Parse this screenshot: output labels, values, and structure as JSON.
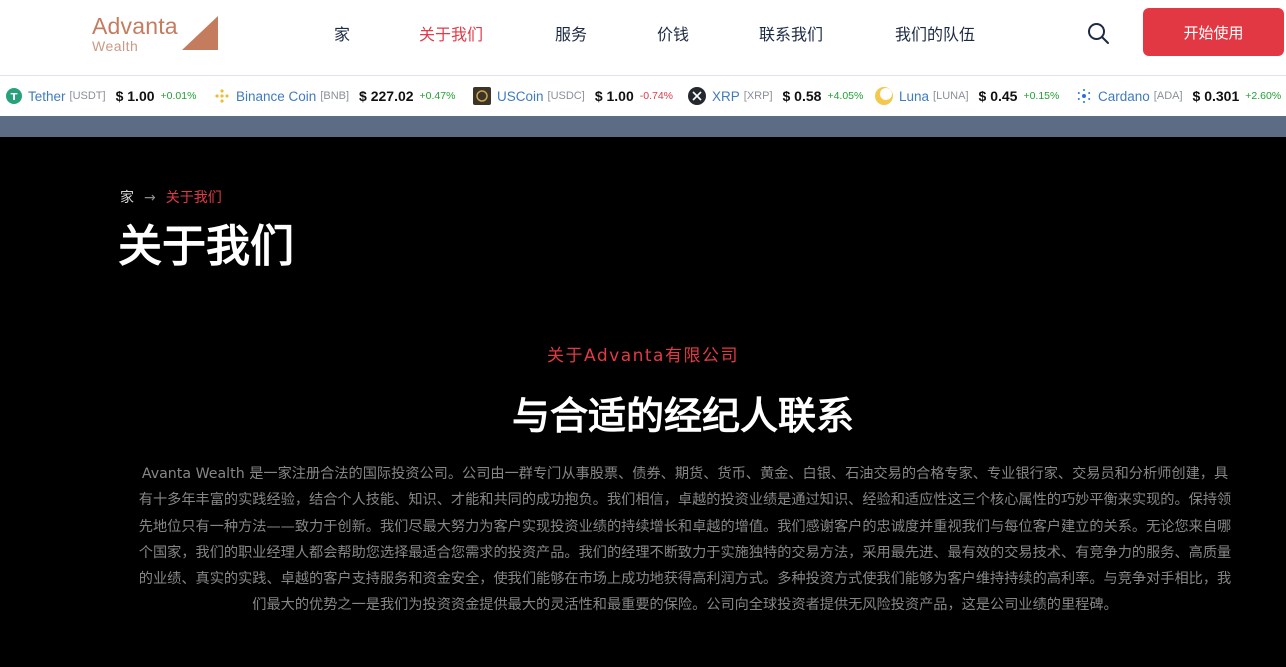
{
  "brand": {
    "name": "Advanta",
    "sub": "Wealth",
    "color": "#c47c5f"
  },
  "nav": [
    {
      "label": "家",
      "active": false
    },
    {
      "label": "关于我们",
      "active": true
    },
    {
      "label": "服务",
      "active": false
    },
    {
      "label": "价钱",
      "active": false
    },
    {
      "label": "联系我们",
      "active": false
    },
    {
      "label": "我们的队伍",
      "active": false
    }
  ],
  "header": {
    "search_icon": "search-icon",
    "cta_label": "开始使用",
    "accent": "#e13843"
  },
  "ticker": [
    {
      "name": "Tether",
      "symbol": "[USDT]",
      "price": "$ 1.00",
      "change": "+0.01%",
      "direction": "up",
      "icon": "tether-icon",
      "icon_color": "#26a17b"
    },
    {
      "name": "Binance Coin",
      "symbol": "[BNB]",
      "price": "$ 227.02",
      "change": "+0.47%",
      "direction": "up",
      "icon": "binance-icon",
      "icon_color": "#f3ba2f"
    },
    {
      "name": "USCoin",
      "symbol": "[USDC]",
      "price": "$ 1.00",
      "change": "-0.74%",
      "direction": "down",
      "icon": "uscoin-icon",
      "icon_color": "#3b3428"
    },
    {
      "name": "XRP",
      "symbol": "[XRP]",
      "price": "$ 0.58",
      "change": "+4.05%",
      "direction": "up",
      "icon": "xrp-icon",
      "icon_color": "#23292f"
    },
    {
      "name": "Luna",
      "symbol": "[LUNA]",
      "price": "$ 0.45",
      "change": "+0.15%",
      "direction": "up",
      "icon": "luna-icon",
      "icon_color": "#f2c94c"
    },
    {
      "name": "Cardano",
      "symbol": "[ADA]",
      "price": "$ 0.301",
      "change": "+2.60%",
      "direction": "up",
      "icon": "cardano-icon",
      "icon_color": "#2a6fdb"
    }
  ],
  "breadcrumb": {
    "home": "家",
    "separator": "→",
    "current": "关于我们"
  },
  "hero": {
    "title": "关于我们"
  },
  "about": {
    "eyebrow": "关于Advanta有限公司",
    "title": "与合适的经纪人联系",
    "body": "Avanta Wealth 是一家注册合法的国际投资公司。公司由一群专门从事股票、债券、期货、货币、黄金、白银、石油交易的合格专家、专业银行家、交易员和分析师创建，具有十多年丰富的实践经验，结合个人技能、知识、才能和共同的成功抱负。我们相信，卓越的投资业绩是通过知识、经验和适应性这三个核心属性的巧妙平衡来实现的。保持领先地位只有一种方法——致力于创新。我们尽最大努力为客户实现投资业绩的持续增长和卓越的增值。我们感谢客户的忠诚度并重视我们与每位客户建立的关系。无论您来自哪个国家，我们的职业经理人都会帮助您选择最适合您需求的投资产品。我们的经理不断致力于实施独特的交易方法，采用最先进、最有效的交易技术、有竞争力的服务、高质量的业绩、真实的实践、卓越的客户支持服务和资金安全，使我们能够在市场上成功地获得高利润方式。多种投资方式使我们能够为客户维持持续的高利率。与竞争对手相比，我们最大的优势之一是我们为投资资金提供最大的灵活性和最重要的保险。公司向全球投资者提供无风险投资产品，这是公司业绩的里程碑。"
  }
}
